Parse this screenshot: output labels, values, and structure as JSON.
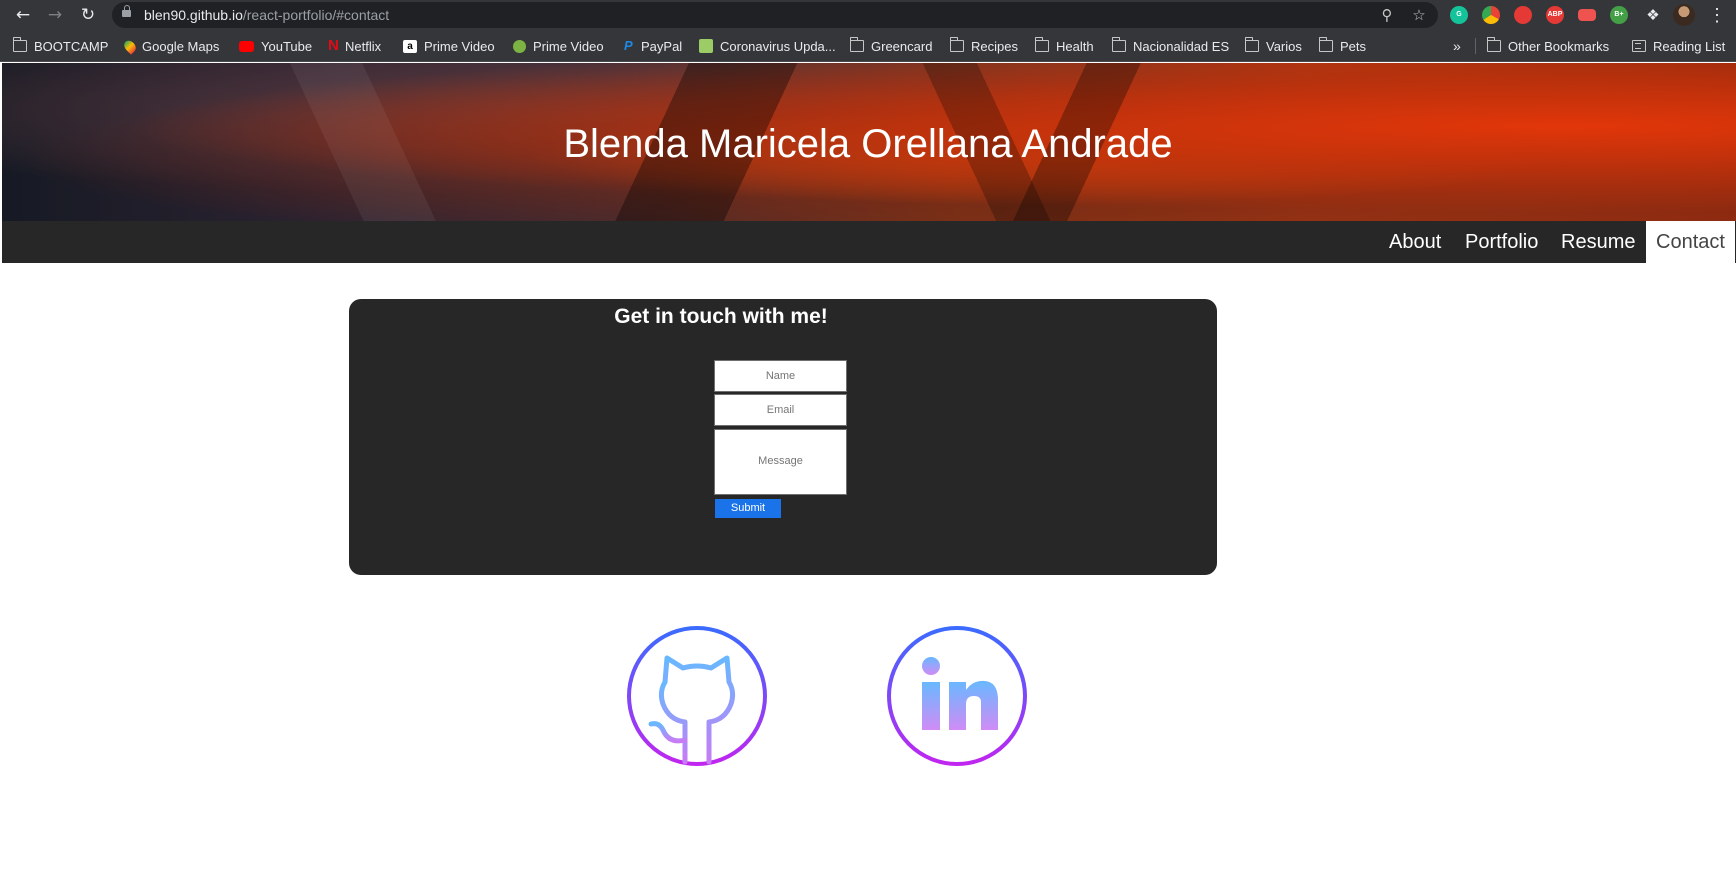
{
  "browser": {
    "url_host": "blen90.github.io",
    "url_path": "/react-portfolio/#contact",
    "extensions": [
      {
        "name": "grammarly-icon",
        "label": "G",
        "color": "#15c39a"
      },
      {
        "name": "chrome-extension-icon",
        "label": "",
        "color": "#f4b400"
      },
      {
        "name": "hand-extension-icon",
        "label": "",
        "color": "#e53935"
      },
      {
        "name": "adblock-plus-icon",
        "label": "ABP",
        "color": "#e53935"
      },
      {
        "name": "video-extension-icon",
        "label": "",
        "color": "#ef5350"
      },
      {
        "name": "b-plus-extension-icon",
        "label": "B+",
        "color": "#43a047"
      }
    ],
    "bookmarks": [
      {
        "label": "BOOTCAMP",
        "icon": "folder-icon"
      },
      {
        "label": "Google Maps",
        "icon": "google-maps-icon"
      },
      {
        "label": "YouTube",
        "icon": "youtube-icon"
      },
      {
        "label": "Netflix",
        "icon": "netflix-icon"
      },
      {
        "label": "Prime Video",
        "icon": "amazon-icon"
      },
      {
        "label": "Prime Video",
        "icon": "play-circle-icon"
      },
      {
        "label": "PayPal",
        "icon": "paypal-icon"
      },
      {
        "label": "Coronavirus Upda...",
        "icon": "bookmark-site-icon"
      },
      {
        "label": "Greencard",
        "icon": "folder-icon"
      },
      {
        "label": "Recipes",
        "icon": "folder-icon"
      },
      {
        "label": "Health",
        "icon": "folder-icon"
      },
      {
        "label": "Nacionalidad ES",
        "icon": "folder-icon"
      },
      {
        "label": "Varios",
        "icon": "folder-icon"
      },
      {
        "label": "Pets",
        "icon": "folder-icon"
      }
    ],
    "overflow_label": "»",
    "other_bookmarks": "Other Bookmarks",
    "reading_list": "Reading List"
  },
  "header": {
    "title": "Blenda Maricela Orellana Andrade"
  },
  "nav": {
    "items": [
      {
        "label": "About",
        "active": false
      },
      {
        "label": "Portfolio",
        "active": false
      },
      {
        "label": "Resume",
        "active": false
      },
      {
        "label": "Contact",
        "active": true
      }
    ]
  },
  "contact": {
    "title": "Get in touch with me!",
    "name_placeholder": "Name",
    "email_placeholder": "Email",
    "message_placeholder": "Message",
    "submit_label": "Submit"
  },
  "social": [
    {
      "name": "github-icon"
    },
    {
      "name": "linkedin-icon"
    }
  ],
  "colors": {
    "navbar": "#272727",
    "card": "#272727",
    "submit": "#1a73e8",
    "icon_gradient_top": "#3b6bff",
    "icon_gradient_bottom": "#c026f0"
  }
}
